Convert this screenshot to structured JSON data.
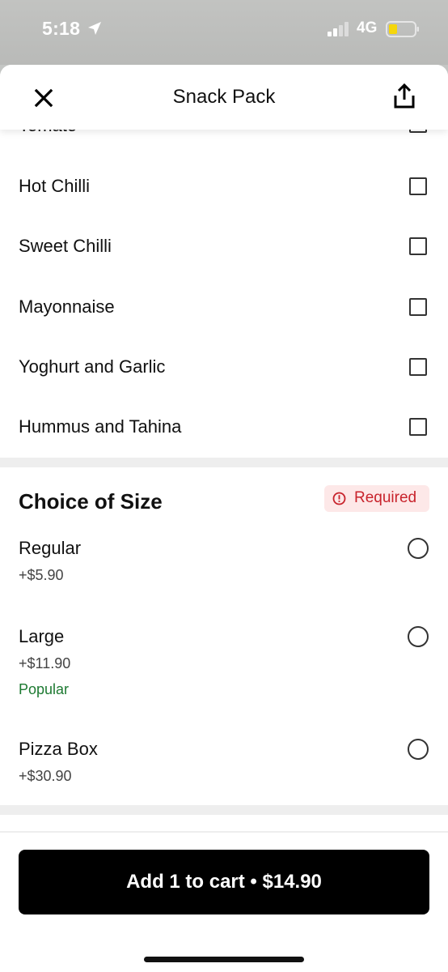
{
  "status_bar": {
    "time": "5:18",
    "network": "4G",
    "icons": [
      "location-arrow-icon",
      "signal-icon",
      "battery-icon"
    ]
  },
  "header": {
    "title": "Snack Pack",
    "close_icon": "close-icon",
    "share_icon": "share-icon"
  },
  "sauces": {
    "partial_label": "Tomato",
    "items": [
      {
        "label": "Hot Chilli"
      },
      {
        "label": "Sweet Chilli"
      },
      {
        "label": "Mayonnaise"
      },
      {
        "label": "Yoghurt and Garlic"
      },
      {
        "label": "Hummus and Tahina"
      }
    ]
  },
  "size_section": {
    "title": "Choice of Size",
    "required_label": "Required",
    "options": [
      {
        "name": "Regular",
        "price": "+$5.90",
        "tag": ""
      },
      {
        "name": "Large",
        "price": "+$11.90",
        "tag": "Popular"
      },
      {
        "name": "Pizza Box",
        "price": "+$30.90",
        "tag": ""
      }
    ]
  },
  "cart_button": {
    "label": "Add 1 to cart • $14.90"
  },
  "colors": {
    "required_bg": "#fde8e8",
    "required_text": "#c8232c",
    "popular_text": "#1d7a32",
    "button_bg": "#000000"
  }
}
